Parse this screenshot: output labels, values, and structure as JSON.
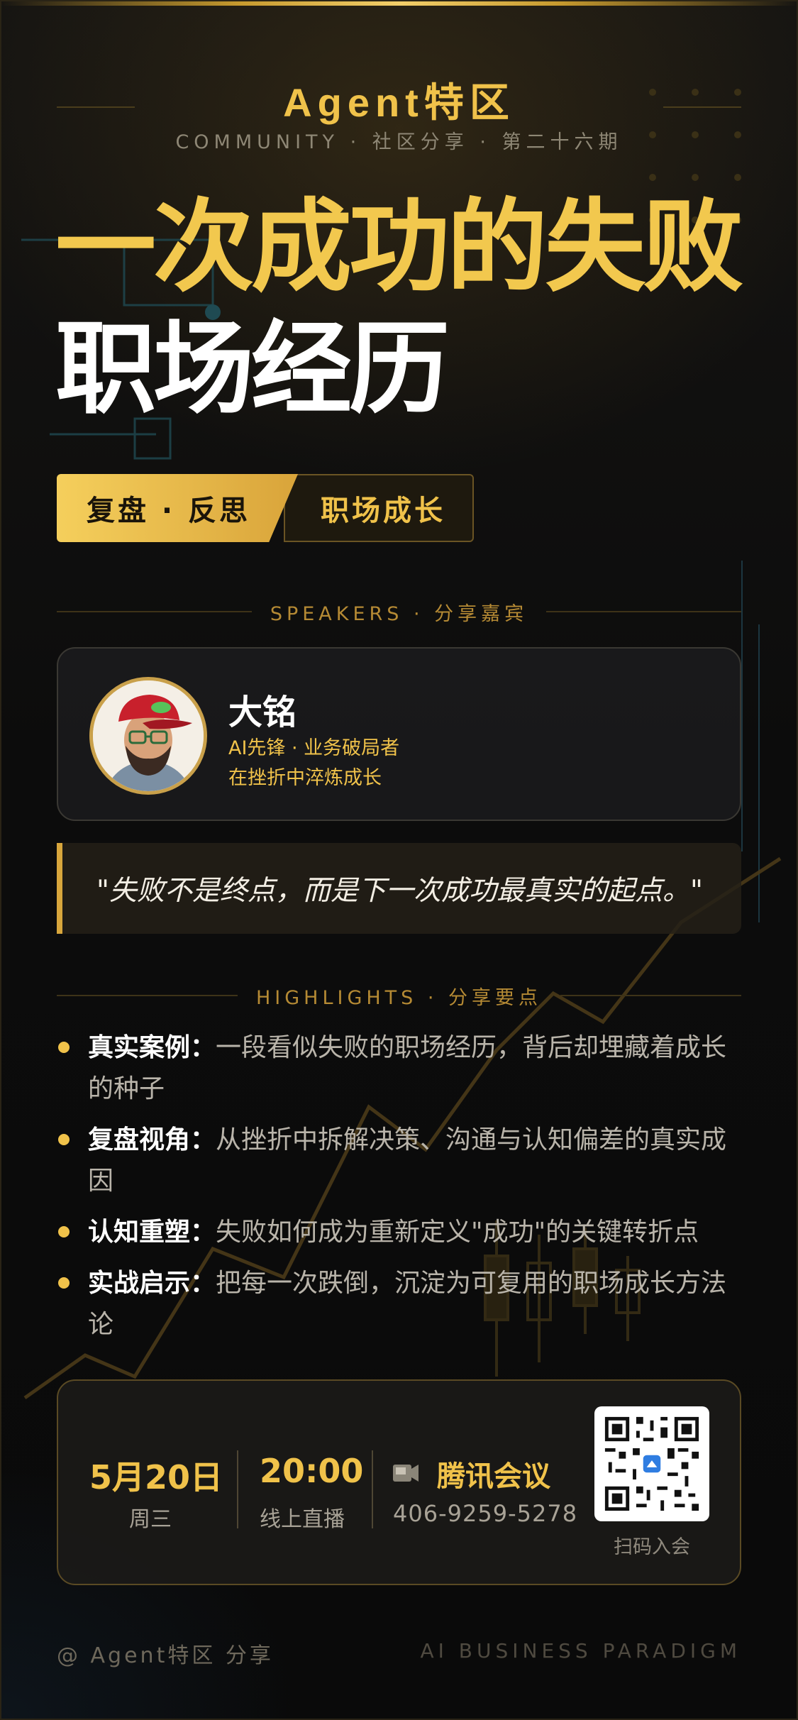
{
  "header": {
    "brand": "Agent特区",
    "subtitle": "COMMUNITY · 社区分享 · 第二十六期"
  },
  "title": {
    "line1": "一次成功的失败",
    "line2": "职场经历"
  },
  "tags": {
    "primary": "复盘 · 反思",
    "secondary": "职场成长"
  },
  "speakers_section": {
    "heading": "SPEAKERS · 分享嘉宾"
  },
  "speaker": {
    "name": "大铭",
    "role": "AI先锋 · 业务破局者",
    "description": "在挫折中淬炼成长"
  },
  "quote": "\"失败不是终点，而是下一次成功最真实的起点。\"",
  "highlights_section": {
    "heading": "HIGHLIGHTS · 分享要点"
  },
  "highlights": [
    {
      "key": "真实案例：",
      "text": "一段看似失败的职场经历，背后却埋藏着成长的种子"
    },
    {
      "key": "复盘视角：",
      "text": "从挫折中拆解决策、沟通与认知偏差的真实成因"
    },
    {
      "key": "认知重塑：",
      "text": "失败如何成为重新定义\"成功\"的关键转折点"
    },
    {
      "key": "实战启示：",
      "text": "把每一次跌倒，沉淀为可复用的职场成长方法论"
    }
  ],
  "event": {
    "date": "5月20日",
    "weekday": "周三",
    "time": "20:00",
    "mode": "线上直播",
    "app": "腾讯会议",
    "meeting_id": "406-9259-5278",
    "qr_caption": "扫码入会"
  },
  "footer": {
    "left": "@ Agent特区 分享",
    "right": "AI BUSINESS PARADIGM"
  },
  "colors": {
    "accent": "#f0c24a",
    "background": "#0b0b0c"
  },
  "icons": {
    "meeting": "video-camera-icon",
    "qr": "qr-code-icon"
  }
}
